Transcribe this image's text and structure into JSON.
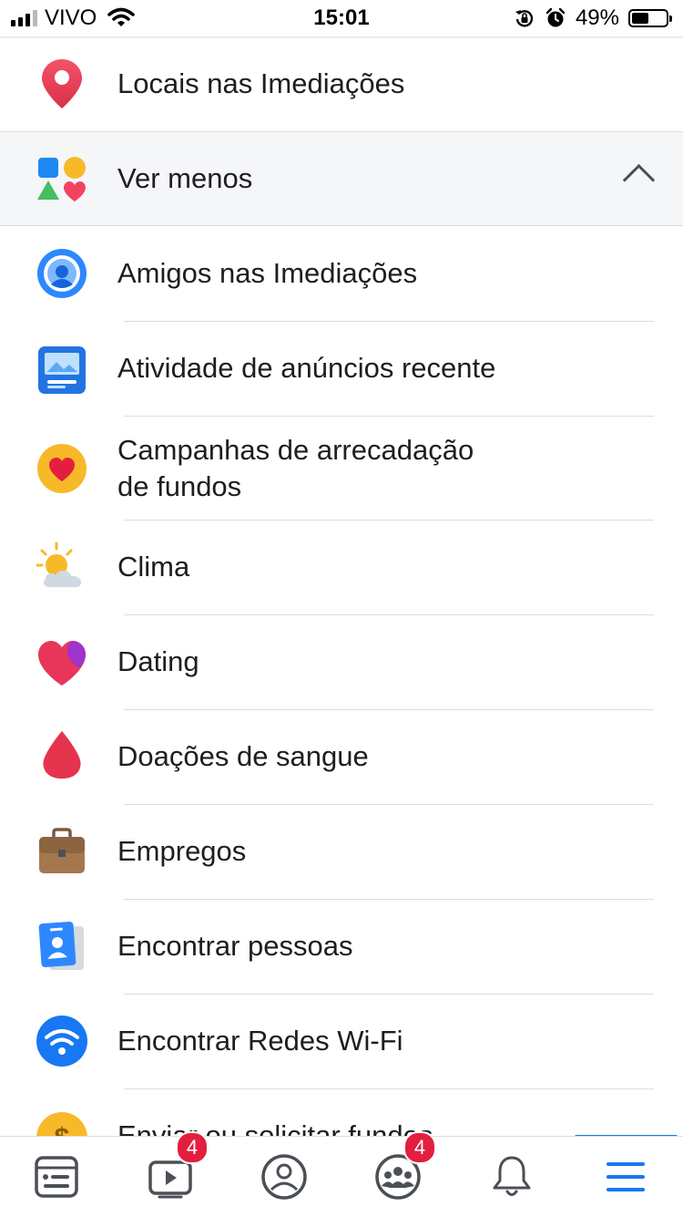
{
  "status_bar": {
    "carrier": "VIVO",
    "time": "15:01",
    "battery": "49%",
    "battery_level": 0.49
  },
  "menu": {
    "nearby_places": "Locais nas Imediações",
    "see_less": "Ver menos",
    "items": [
      {
        "label": "Amigos nas Imediações",
        "icon": "nearby-friends-icon"
      },
      {
        "label": "Atividade de anúncios recente",
        "icon": "recent-ad-activity-icon"
      },
      {
        "label": "Campanhas de arrecadação",
        "label2": "de fundos",
        "icon": "fundraisers-icon"
      },
      {
        "label": "Clima",
        "icon": "weather-icon"
      },
      {
        "label": "Dating",
        "icon": "dating-icon"
      },
      {
        "label": "Doações de sangue",
        "icon": "blood-donation-icon"
      },
      {
        "label": "Empregos",
        "icon": "jobs-icon"
      },
      {
        "label": "Encontrar pessoas",
        "icon": "find-people-icon"
      },
      {
        "label": "Encontrar Redes Wi-Fi",
        "icon": "find-wifi-icon"
      },
      {
        "label": "Enviar ou solicitar fundos",
        "icon": "send-request-money-icon"
      }
    ]
  },
  "tab_bar": {
    "watch_badge": "4",
    "groups_badge": "4",
    "active_tab": "menu"
  },
  "colors": {
    "accent": "#1877f2",
    "badge": "#e41e3f",
    "text": "#1c1e21",
    "see_less_bg": "#f5f6f7"
  }
}
